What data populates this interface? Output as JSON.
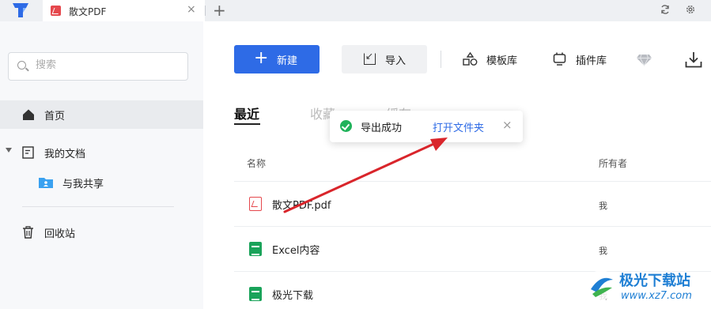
{
  "titlebar": {
    "tab_title": "散文PDF",
    "tab_close": "×",
    "new_tab": "+",
    "sync_icon": "sync-icon",
    "settings_icon": "gear-icon"
  },
  "sidebar": {
    "search_placeholder": "搜索",
    "items": [
      {
        "label": "首页",
        "icon": "home-icon",
        "active": true
      },
      {
        "label": "我的文档",
        "icon": "document-icon",
        "expanded": true
      },
      {
        "label": "与我共享",
        "icon": "shared-folder-icon"
      },
      {
        "label": "回收站",
        "icon": "trash-icon"
      }
    ]
  },
  "toolbar": {
    "new_label": "新建",
    "new_plus": "+",
    "import_label": "导入",
    "template_label": "模板库",
    "plugin_label": "插件库",
    "vip_icon": "diamond-icon",
    "download_icon": "download-icon"
  },
  "tabs": [
    {
      "label": "最近",
      "active": true
    },
    {
      "label": "收藏",
      "active": false
    },
    {
      "label": "缓存",
      "active": false
    }
  ],
  "table": {
    "columns": [
      "名称",
      "所有者"
    ],
    "rows": [
      {
        "name": "散文PDF.pdf",
        "owner": "我",
        "type": "pdf"
      },
      {
        "name": "Excel内容",
        "owner": "我",
        "type": "excel"
      },
      {
        "name": "极光下载",
        "owner": "我",
        "type": "excel"
      }
    ]
  },
  "toast": {
    "message": "导出成功",
    "link": "打开文件夹",
    "close": "×"
  },
  "watermark": {
    "name": "极光下载站",
    "url": "www.xz7.com"
  },
  "colors": {
    "accent": "#2e6be6",
    "success": "#1fb25a",
    "pdf": "#e5484d",
    "excel": "#1aa35a",
    "annotation_arrow": "#d9252b"
  }
}
